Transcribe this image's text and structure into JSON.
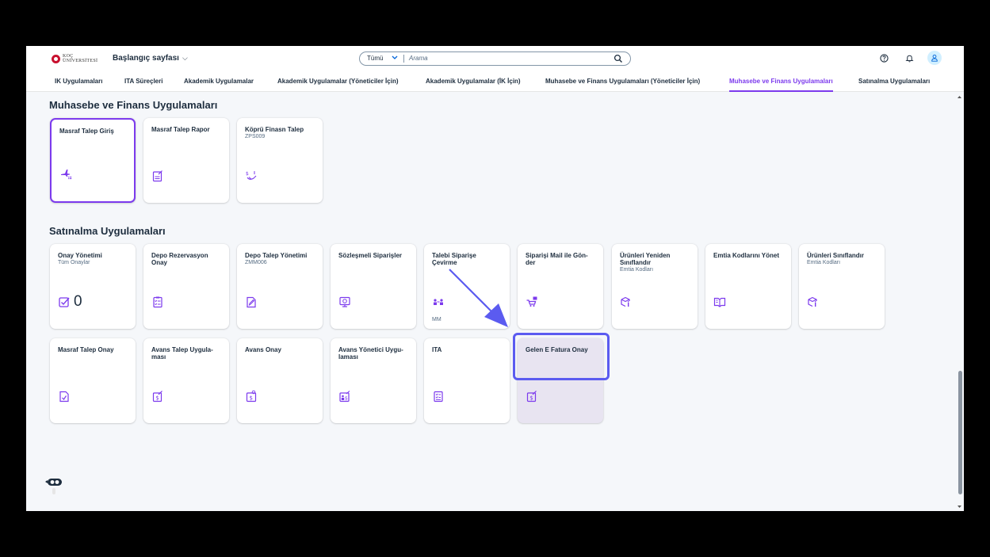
{
  "shell": {
    "logo_text_top": "KOÇ",
    "logo_text_bottom": "ÜNİVERSİTESİ",
    "home_title": "Başlangıç sayfası",
    "home_chevron": "⌵",
    "search_scope": "Tümü",
    "search_placeholder": "Arama",
    "icons": [
      "help-icon",
      "bell-icon",
      "user-icon"
    ]
  },
  "tabs": [
    {
      "label": "IK Uygulamaları"
    },
    {
      "label": "ITA Süreçleri"
    },
    {
      "label": "Akademik Uygulamalar"
    },
    {
      "label": "Akademik Uygulamalar (Yöneticiler İçin)"
    },
    {
      "label": "Akademik Uygulamalar (İK İçin)"
    },
    {
      "label": "Muhasebe ve Finans Uygulamaları (Yöneticiler İçin)"
    },
    {
      "label": "Muhasebe ve Finans Uygulamaları",
      "active": true
    },
    {
      "label": "Satınalma Uygulamaları"
    }
  ],
  "sections": [
    {
      "title": "Muhasebe ve Finans Uygulamaları",
      "tiles": [
        {
          "title": "Masraf Talep Giriş",
          "sub": "",
          "icon": "travel-expense-icon",
          "selected": true
        },
        {
          "title": "Masraf Talep Rapor",
          "sub": "",
          "icon": "expense-report-icon"
        },
        {
          "title": "Köprü Finasn Talep",
          "sub": "ZPS009",
          "icon": "money-hand-icon"
        }
      ]
    },
    {
      "title": "Satınalma Uygulamaları",
      "tiles": [
        {
          "title": "Onay Yönetimi",
          "sub": "Tüm Onaylar",
          "icon": "approval-check-icon",
          "number": "0"
        },
        {
          "title": "Depo Rezervasyon Onay",
          "sub": "",
          "icon": "checklist-icon"
        },
        {
          "title": "Depo Talep Yönetimi",
          "sub": "ZMM006",
          "icon": "edit-document-icon"
        },
        {
          "title": "Sözleşmeli Siparişler",
          "sub": "",
          "icon": "contract-screen-icon"
        },
        {
          "title": "Talebi Siparişe Çevirme",
          "sub": "",
          "icon": "people-transfer-icon",
          "footer": "MM"
        },
        {
          "title": "Siparişi Mail ile Gön-der",
          "sub": "",
          "icon": "mail-cart-icon"
        },
        {
          "title": "Ürünleri Yeniden Sınıflandır",
          "sub": "Emtia Kodları",
          "icon": "product-classify-icon"
        },
        {
          "title": "Emtia Kodlarını Yönet",
          "sub": "",
          "icon": "open-book-icon"
        },
        {
          "title": "Ürünleri Sınıflandır",
          "sub": "Emtia Kodları",
          "icon": "product-classify-icon"
        },
        {
          "title": "Masraf Talep Onay",
          "sub": "",
          "icon": "document-approve-icon"
        },
        {
          "title": "Avans Talep Uygula-ması",
          "sub": "",
          "icon": "dollar-document-icon"
        },
        {
          "title": "Avans Onay",
          "sub": "",
          "icon": "dollar-approval-icon"
        },
        {
          "title": "Avans Yönetici Uygu-laması",
          "sub": "",
          "icon": "manager-dollar-icon"
        },
        {
          "title": "ITA",
          "sub": "",
          "icon": "checklist-document-icon"
        },
        {
          "title": "Gelen E Fatura Onay",
          "sub": "",
          "icon": "dollar-document-icon",
          "highlighted": true
        }
      ]
    }
  ],
  "annotation": {
    "arrow_color": "#5b5bf0",
    "highlight_color": "#5b5bf0"
  },
  "colors": {
    "accent": "#7c3aed",
    "text": "#1d2d3e",
    "background": "#f5f7fa"
  }
}
